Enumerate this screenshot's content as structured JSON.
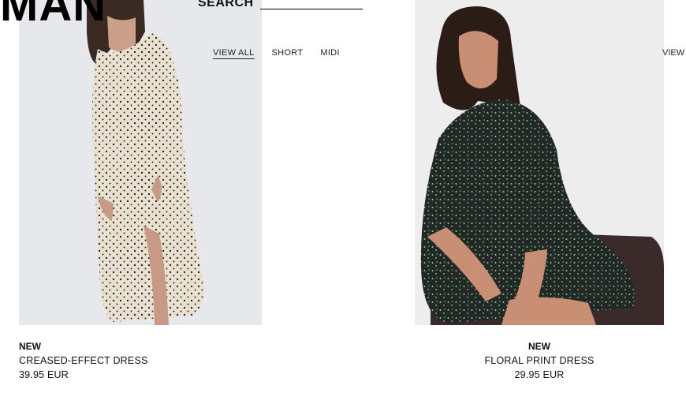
{
  "header": {
    "logo": "MAN",
    "search_label": "SEARCH",
    "search_value": ""
  },
  "subnav": {
    "items": [
      "VIEW ALL",
      "SHORT",
      "MIDI"
    ],
    "right_item": "VIEW"
  },
  "products": [
    {
      "tag": "NEW",
      "name": "CREASED-EFFECT DRESS",
      "price": "39.95 EUR"
    },
    {
      "tag": "NEW",
      "name": "FLORAL PRINT DRESS",
      "price": "29.95 EUR"
    }
  ],
  "colors": {
    "text": "#111111",
    "background": "#ffffff"
  }
}
